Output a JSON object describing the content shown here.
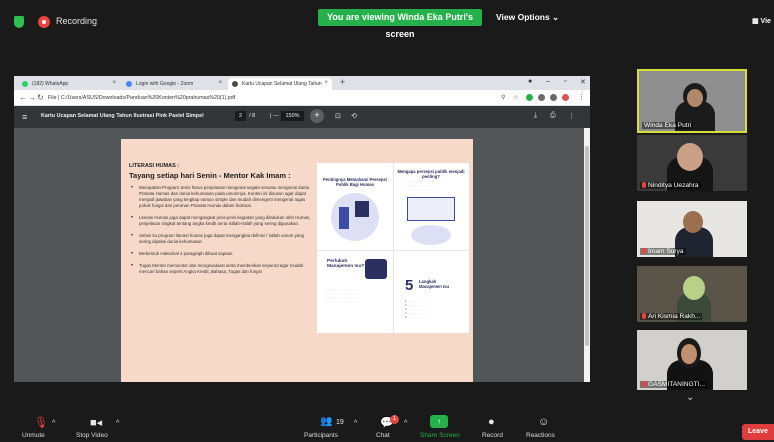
{
  "topbar": {
    "recording_label": "Recording",
    "viewing_banner": "You are viewing Winda Eka Putri's screen",
    "view_options": "View Options ⌄",
    "gallery_view": "▦ Vie"
  },
  "browser": {
    "tabs": [
      {
        "label": "(182) WhatsApp",
        "icon_color": "#25d366"
      },
      {
        "label": "Login with Google - Zoom",
        "icon_color": "#4285f4"
      },
      {
        "label": "Kartu Ucapan Selamat Ulang Tahun",
        "icon_color": "#4a4a4a"
      }
    ],
    "new_tab": "+",
    "url": "File  |  C:/Users/ASUS/Downloads/Panduan%20Konten%20prahumas%20(1).pdf",
    "pdf": {
      "title": "Kartu Ucapan Selamat Ulang Tahun Ilustrasi Pink Pastel Simpel",
      "page_current": "2",
      "page_total": "/ 8",
      "zoom": "150%",
      "zoom_minus": "—",
      "zoom_plus": "+"
    },
    "page": {
      "title": "LITERASI HUMAS :",
      "subtitle": "Tayang setiap hari Senin - Mentor Kak Imam :",
      "bullets": [
        "Merupakan Program Jenis harus penjelasan mengenai segala sesuatu mengenai dunia Pranata Humas dan dunia kehumasan pada umumnya. Konten ini disusun agar dapat menjadi jawaban yang lengkap namun simple dan mudah dimengerti mengenai tugas pokok fungsi dan peranan Pranata Humas dalam biokrasi.",
        "Literasi Humas juga dapat mengangkat jenis-jenis kegiatan yang dilakukan oleh Humas, penjelasan singkat tentang angka kredit serta istilah-istilah yang sering digunakan.",
        "Selain itu program literasi humas juga dapat mengangkat definisi / istilah umum yang sering dipakai dunia kehumasan",
        "Berbentuk maksimal 4 paragraph dibuat sapaan",
        "Tugas Mentor memonitor dan mengevaluasi serta memberikan keyword agar mudah mencari bahan seperti Angka Kredit, Bahasa, Tugas dan fungsi"
      ],
      "infographic": {
        "card1_title": "Pentingnya Memahami Persepsi Publik Bagi Humas",
        "card2_title": "Mengapa persepsi publik menjadi penting?",
        "card3_title": "Perlukah Manajemen Isu?",
        "card4_number": "5",
        "card4_title": "Langkah Manajemen Isu"
      }
    }
  },
  "participants": [
    {
      "name": "Winda Eka Putri",
      "muted": false
    },
    {
      "name": "Ninditya Uezahra",
      "muted": true
    },
    {
      "name": "Imam Surya",
      "muted": true
    },
    {
      "name": "Ari Kismia Rakh...",
      "muted": true
    },
    {
      "name": "GASMITANINGTI...",
      "muted": true
    }
  ],
  "toolbar": {
    "unmute": "Unmute",
    "stop_video": "Stop Video",
    "participants": "Participants",
    "participants_count": "19",
    "chat": "Chat",
    "chat_badge": "1",
    "share_screen": "Share Screen",
    "record": "Record",
    "reactions": "Reactions",
    "leave": "Leave"
  },
  "colors": {
    "zoom_green": "#26b04a",
    "leave_red": "#e03e3e",
    "active_speaker": "#d6de3a",
    "pdf_page_bg": "#f7d9c9"
  }
}
